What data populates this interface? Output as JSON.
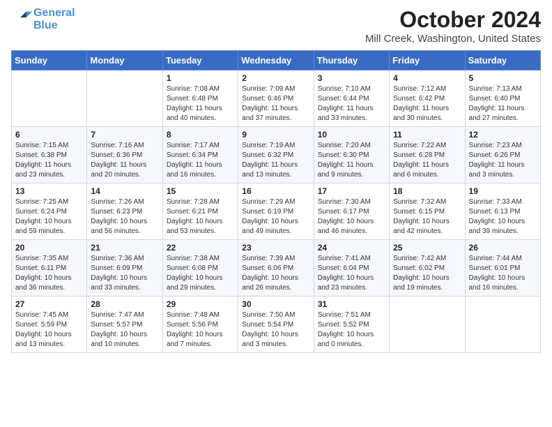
{
  "header": {
    "logo_line1": "General",
    "logo_line2": "Blue",
    "title": "October 2024",
    "subtitle": "Mill Creek, Washington, United States"
  },
  "days_of_week": [
    "Sunday",
    "Monday",
    "Tuesday",
    "Wednesday",
    "Thursday",
    "Friday",
    "Saturday"
  ],
  "weeks": [
    [
      {
        "day": "",
        "info": ""
      },
      {
        "day": "",
        "info": ""
      },
      {
        "day": "1",
        "info": "Sunrise: 7:08 AM\nSunset: 6:48 PM\nDaylight: 11 hours and 40 minutes."
      },
      {
        "day": "2",
        "info": "Sunrise: 7:09 AM\nSunset: 6:46 PM\nDaylight: 11 hours and 37 minutes."
      },
      {
        "day": "3",
        "info": "Sunrise: 7:10 AM\nSunset: 6:44 PM\nDaylight: 11 hours and 33 minutes."
      },
      {
        "day": "4",
        "info": "Sunrise: 7:12 AM\nSunset: 6:42 PM\nDaylight: 11 hours and 30 minutes."
      },
      {
        "day": "5",
        "info": "Sunrise: 7:13 AM\nSunset: 6:40 PM\nDaylight: 11 hours and 27 minutes."
      }
    ],
    [
      {
        "day": "6",
        "info": "Sunrise: 7:15 AM\nSunset: 6:38 PM\nDaylight: 11 hours and 23 minutes."
      },
      {
        "day": "7",
        "info": "Sunrise: 7:16 AM\nSunset: 6:36 PM\nDaylight: 11 hours and 20 minutes."
      },
      {
        "day": "8",
        "info": "Sunrise: 7:17 AM\nSunset: 6:34 PM\nDaylight: 11 hours and 16 minutes."
      },
      {
        "day": "9",
        "info": "Sunrise: 7:19 AM\nSunset: 6:32 PM\nDaylight: 11 hours and 13 minutes."
      },
      {
        "day": "10",
        "info": "Sunrise: 7:20 AM\nSunset: 6:30 PM\nDaylight: 11 hours and 9 minutes."
      },
      {
        "day": "11",
        "info": "Sunrise: 7:22 AM\nSunset: 6:28 PM\nDaylight: 11 hours and 6 minutes."
      },
      {
        "day": "12",
        "info": "Sunrise: 7:23 AM\nSunset: 6:26 PM\nDaylight: 11 hours and 3 minutes."
      }
    ],
    [
      {
        "day": "13",
        "info": "Sunrise: 7:25 AM\nSunset: 6:24 PM\nDaylight: 10 hours and 59 minutes."
      },
      {
        "day": "14",
        "info": "Sunrise: 7:26 AM\nSunset: 6:23 PM\nDaylight: 10 hours and 56 minutes."
      },
      {
        "day": "15",
        "info": "Sunrise: 7:28 AM\nSunset: 6:21 PM\nDaylight: 10 hours and 53 minutes."
      },
      {
        "day": "16",
        "info": "Sunrise: 7:29 AM\nSunset: 6:19 PM\nDaylight: 10 hours and 49 minutes."
      },
      {
        "day": "17",
        "info": "Sunrise: 7:30 AM\nSunset: 6:17 PM\nDaylight: 10 hours and 46 minutes."
      },
      {
        "day": "18",
        "info": "Sunrise: 7:32 AM\nSunset: 6:15 PM\nDaylight: 10 hours and 42 minutes."
      },
      {
        "day": "19",
        "info": "Sunrise: 7:33 AM\nSunset: 6:13 PM\nDaylight: 10 hours and 39 minutes."
      }
    ],
    [
      {
        "day": "20",
        "info": "Sunrise: 7:35 AM\nSunset: 6:11 PM\nDaylight: 10 hours and 36 minutes."
      },
      {
        "day": "21",
        "info": "Sunrise: 7:36 AM\nSunset: 6:09 PM\nDaylight: 10 hours and 33 minutes."
      },
      {
        "day": "22",
        "info": "Sunrise: 7:38 AM\nSunset: 6:08 PM\nDaylight: 10 hours and 29 minutes."
      },
      {
        "day": "23",
        "info": "Sunrise: 7:39 AM\nSunset: 6:06 PM\nDaylight: 10 hours and 26 minutes."
      },
      {
        "day": "24",
        "info": "Sunrise: 7:41 AM\nSunset: 6:04 PM\nDaylight: 10 hours and 23 minutes."
      },
      {
        "day": "25",
        "info": "Sunrise: 7:42 AM\nSunset: 6:02 PM\nDaylight: 10 hours and 19 minutes."
      },
      {
        "day": "26",
        "info": "Sunrise: 7:44 AM\nSunset: 6:01 PM\nDaylight: 10 hours and 16 minutes."
      }
    ],
    [
      {
        "day": "27",
        "info": "Sunrise: 7:45 AM\nSunset: 5:59 PM\nDaylight: 10 hours and 13 minutes."
      },
      {
        "day": "28",
        "info": "Sunrise: 7:47 AM\nSunset: 5:57 PM\nDaylight: 10 hours and 10 minutes."
      },
      {
        "day": "29",
        "info": "Sunrise: 7:48 AM\nSunset: 5:56 PM\nDaylight: 10 hours and 7 minutes."
      },
      {
        "day": "30",
        "info": "Sunrise: 7:50 AM\nSunset: 5:54 PM\nDaylight: 10 hours and 3 minutes."
      },
      {
        "day": "31",
        "info": "Sunrise: 7:51 AM\nSunset: 5:52 PM\nDaylight: 10 hours and 0 minutes."
      },
      {
        "day": "",
        "info": ""
      },
      {
        "day": "",
        "info": ""
      }
    ]
  ]
}
